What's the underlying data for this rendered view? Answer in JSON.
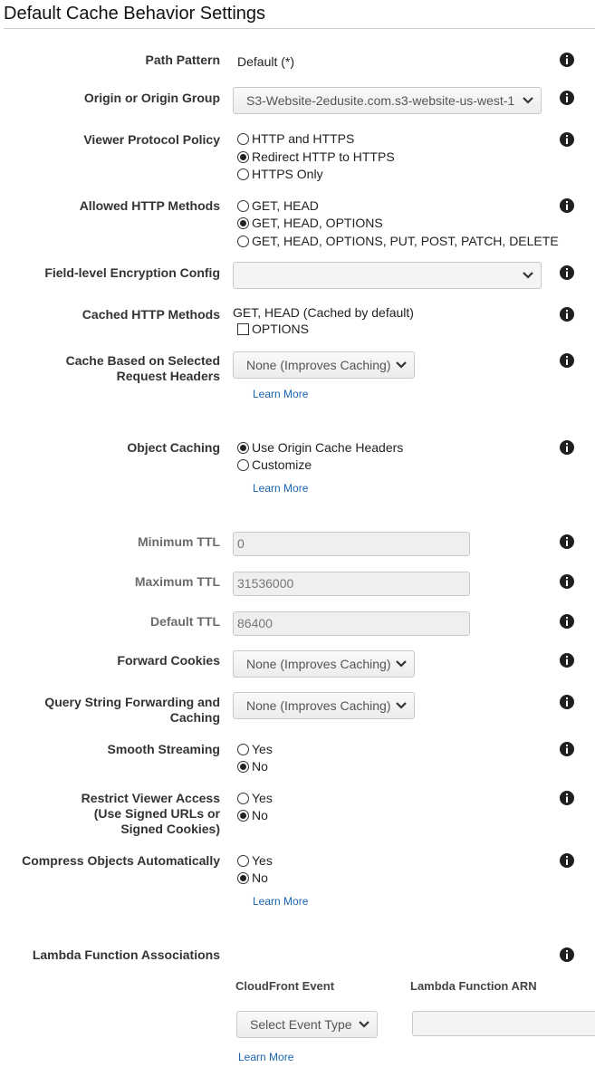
{
  "page": {
    "title": "Default Cache Behavior Settings"
  },
  "colors": {
    "link": "#1a63b0",
    "label": "#333333",
    "muted_label": "#6b6b6b"
  },
  "icons": {
    "info": "info-circle-icon",
    "dropdown": "chevron-down-icon"
  },
  "path_pattern": {
    "label": "Path Pattern",
    "value": "Default (*)"
  },
  "origin": {
    "label": "Origin or Origin Group",
    "selected": "S3-Website-2edusite.com.s3-website-us-west-1"
  },
  "viewer_protocol": {
    "label": "Viewer Protocol Policy",
    "options": [
      "HTTP and HTTPS",
      "Redirect HTTP to HTTPS",
      "HTTPS Only"
    ],
    "selected_index": 1
  },
  "allowed_methods": {
    "label": "Allowed HTTP Methods",
    "options": [
      "GET, HEAD",
      "GET, HEAD, OPTIONS",
      "GET, HEAD, OPTIONS, PUT, POST, PATCH, DELETE"
    ],
    "selected_index": 1
  },
  "field_encryption": {
    "label": "Field-level Encryption Config",
    "selected": ""
  },
  "cached_methods": {
    "label": "Cached HTTP Methods",
    "value": "GET, HEAD (Cached by default)",
    "options_checkbox": "OPTIONS",
    "options_checked": false
  },
  "cache_headers": {
    "label_line1": "Cache Based on Selected",
    "label_line2": "Request Headers",
    "selected": "None (Improves Caching)",
    "learn_more": "Learn More"
  },
  "object_caching": {
    "label": "Object Caching",
    "options": [
      "Use Origin Cache Headers",
      "Customize"
    ],
    "selected_index": 0,
    "learn_more": "Learn More"
  },
  "minimum_ttl": {
    "label": "Minimum TTL",
    "value": "0"
  },
  "maximum_ttl": {
    "label": "Maximum TTL",
    "value": "31536000"
  },
  "default_ttl": {
    "label": "Default TTL",
    "value": "86400"
  },
  "forward_cookies": {
    "label": "Forward Cookies",
    "selected": "None (Improves Caching)"
  },
  "query_string": {
    "label_line1": "Query String Forwarding and",
    "label_line2": "Caching",
    "selected": "None (Improves Caching)"
  },
  "smooth_streaming": {
    "label": "Smooth Streaming",
    "options": [
      "Yes",
      "No"
    ],
    "selected_index": 1
  },
  "restrict_viewer": {
    "label_line1": "Restrict Viewer Access",
    "label_line2": "(Use Signed URLs or",
    "label_line3": "Signed Cookies)",
    "options": [
      "Yes",
      "No"
    ],
    "selected_index": 1
  },
  "compress": {
    "label": "Compress Objects Automatically",
    "options": [
      "Yes",
      "No"
    ],
    "selected_index": 1,
    "learn_more": "Learn More"
  },
  "lambda": {
    "label": "Lambda Function Associations",
    "col_event": "CloudFront Event",
    "col_arn": "Lambda Function ARN",
    "event_selected": "Select Event Type",
    "arn_value": "",
    "learn_more": "Learn More"
  }
}
